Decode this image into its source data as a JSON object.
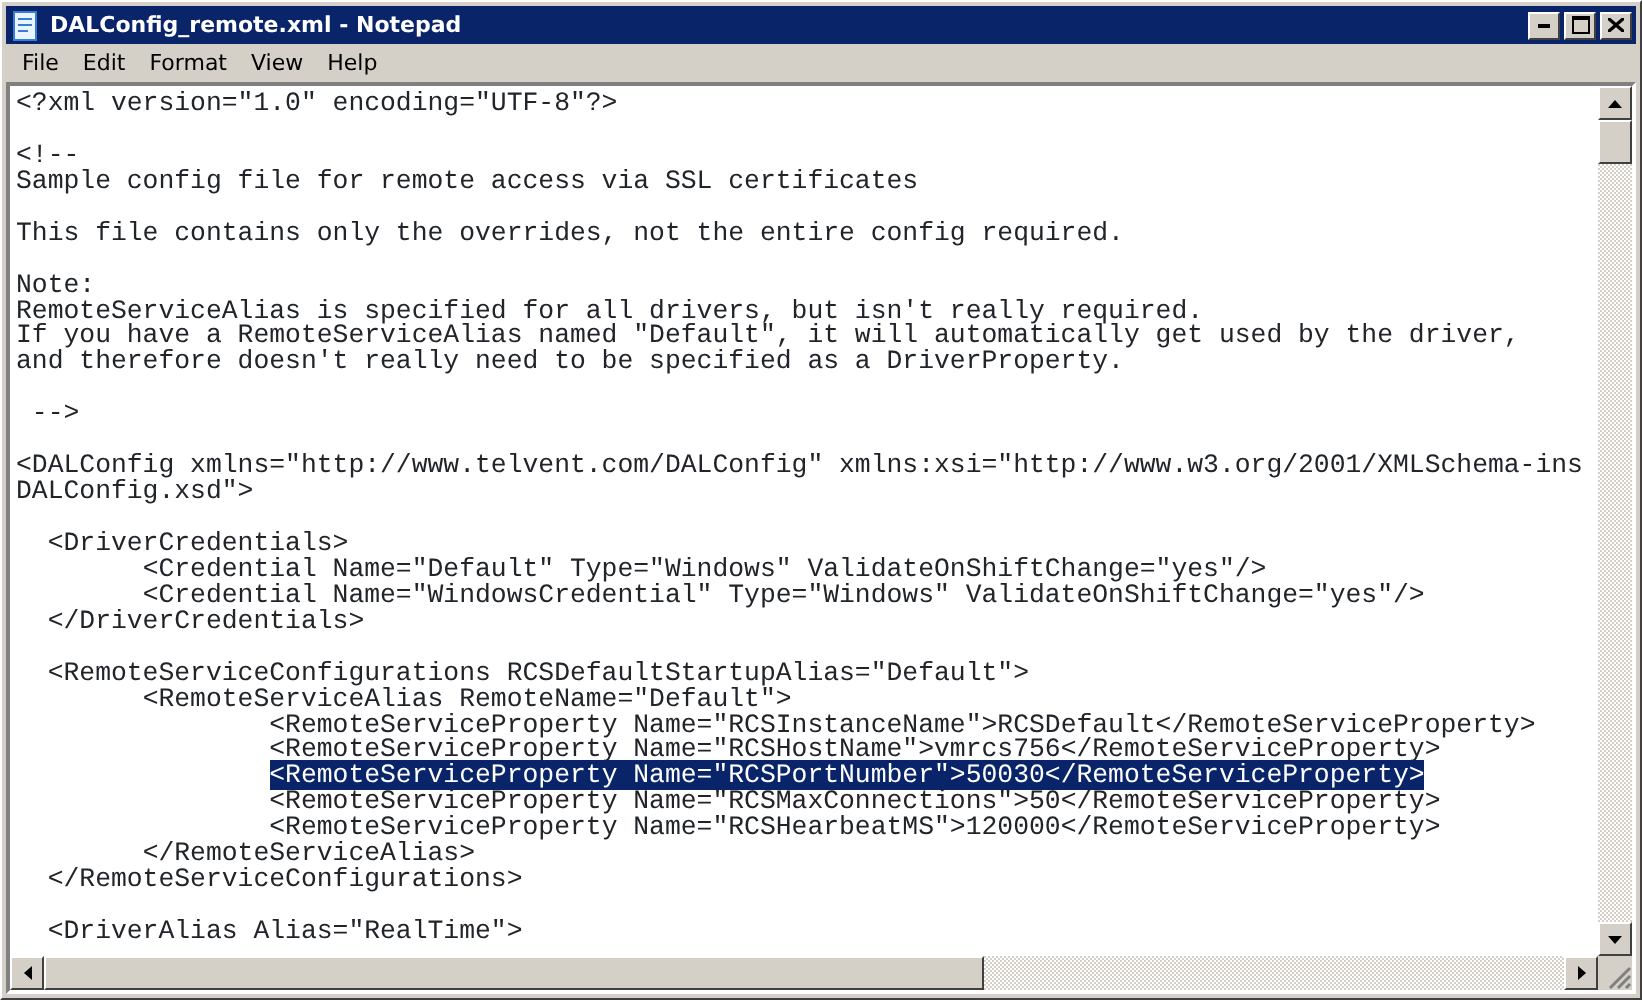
{
  "window": {
    "title": "DALConfig_remote.xml - Notepad"
  },
  "menu": [
    "File",
    "Edit",
    "Format",
    "View",
    "Help"
  ],
  "lines": [
    {
      "kind": "text",
      "text": "<?xml version=\"1.0\" encoding=\"UTF-8\"?>",
      "selected": false
    },
    {
      "kind": "blank"
    },
    {
      "kind": "text",
      "text": "<!--",
      "selected": false
    },
    {
      "kind": "text",
      "text": "Sample config file for remote access via SSL certificates",
      "selected": false
    },
    {
      "kind": "blank"
    },
    {
      "kind": "text",
      "text": "This file contains only the overrides, not the entire config required.",
      "selected": false
    },
    {
      "kind": "blank"
    },
    {
      "kind": "text",
      "text": "Note:",
      "selected": false
    },
    {
      "kind": "text",
      "text": "RemoteServiceAlias is specified for all drivers, but isn't really required.",
      "selected": false
    },
    {
      "kind": "text",
      "text": "If you have a RemoteServiceAlias named \"Default\", it will automatically get used by the driver,",
      "selected": false
    },
    {
      "kind": "text",
      "text": "and therefore doesn't really need to be specified as a DriverProperty.",
      "selected": false
    },
    {
      "kind": "blank"
    },
    {
      "kind": "text",
      "text": " -->",
      "selected": false
    },
    {
      "kind": "blank"
    },
    {
      "kind": "text",
      "text": "<DALConfig xmlns=\"http://www.telvent.com/DALConfig\" xmlns:xsi=\"http://www.w3.org/2001/XMLSchema-ins",
      "selected": false
    },
    {
      "kind": "text",
      "text": "DALConfig.xsd\">",
      "selected": false
    },
    {
      "kind": "blank"
    },
    {
      "kind": "text",
      "text": "  <DriverCredentials>",
      "selected": false
    },
    {
      "kind": "text",
      "text": "  \t<Credential Name=\"Default\" Type=\"Windows\" ValidateOnShiftChange=\"yes\"/>",
      "selected": false
    },
    {
      "kind": "text",
      "text": "  \t<Credential Name=\"WindowsCredential\" Type=\"Windows\" ValidateOnShiftChange=\"yes\"/>",
      "selected": false
    },
    {
      "kind": "text",
      "text": "  </DriverCredentials>",
      "selected": false
    },
    {
      "kind": "blank"
    },
    {
      "kind": "text",
      "text": "  <RemoteServiceConfigurations RCSDefaultStartupAlias=\"Default\">",
      "selected": false
    },
    {
      "kind": "text",
      "text": "  \t<RemoteServiceAlias RemoteName=\"Default\">",
      "selected": false
    },
    {
      "kind": "text",
      "text": "  \t\t<RemoteServiceProperty Name=\"RCSInstanceName\">RCSDefault</RemoteServiceProperty>",
      "selected": false
    },
    {
      "kind": "text",
      "text": "  \t\t<RemoteServiceProperty Name=\"RCSHostName\">vmrcs756</RemoteServiceProperty>",
      "selected": false
    },
    {
      "kind": "text",
      "text": "  \t\t<RemoteServiceProperty Name=\"RCSPortNumber\">50030</RemoteServiceProperty>",
      "selected": true
    },
    {
      "kind": "text",
      "text": "  \t\t<RemoteServiceProperty Name=\"RCSMaxConnections\">50</RemoteServiceProperty>",
      "selected": false
    },
    {
      "kind": "text",
      "text": "  \t\t<RemoteServiceProperty Name=\"RCSHearbeatMS\">120000</RemoteServiceProperty>",
      "selected": false
    },
    {
      "kind": "text",
      "text": "  \t</RemoteServiceAlias>",
      "selected": false
    },
    {
      "kind": "text",
      "text": "  </RemoteServiceConfigurations>",
      "selected": false
    },
    {
      "kind": "blank"
    },
    {
      "kind": "text",
      "text": "  <DriverAlias Alias=\"RealTime\">",
      "selected": false
    }
  ]
}
